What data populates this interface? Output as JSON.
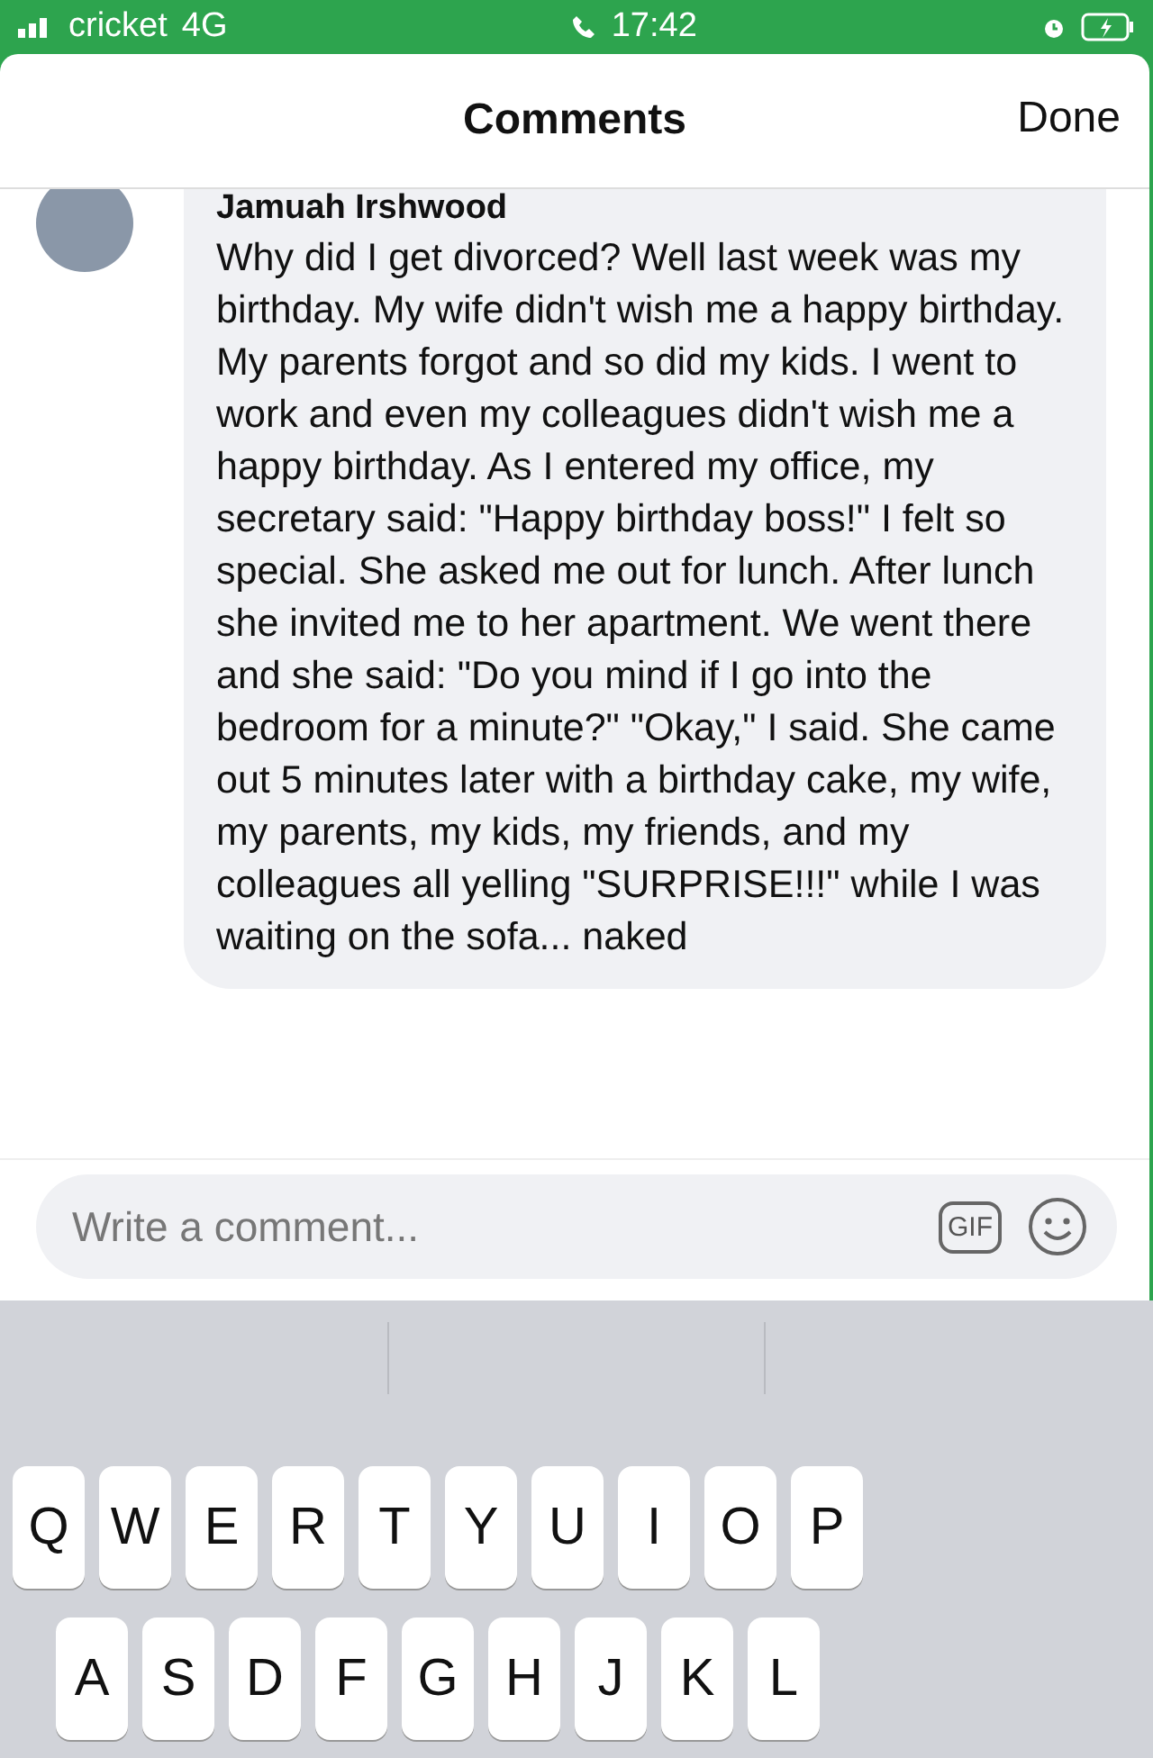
{
  "status_bar": {
    "carrier": "cricket",
    "network": "4G",
    "time": "17:42"
  },
  "header": {
    "title": "Comments",
    "done": "Done"
  },
  "comment": {
    "author": "Jamuah Irshwood",
    "text": "Why did I get divorced? Well last week was my birthday. My wife didn't wish me a happy birthday. My parents forgot and so did my kids. I went to work and even my colleagues didn't wish me a happy birthday. As I entered my office, my secretary said: \"Happy birthday boss!\" I felt so special. She asked me out for lunch. After lunch she invited me to her apartment. We went there and she said: \"Do you mind if I go into the bedroom for a minute?\" \"Okay,\" I said. She came out 5 minutes later with a birthday cake, my wife, my parents, my kids, my friends, and my colleagues all yelling \"SURPRISE!!!\" while I was waiting on the sofa... naked"
  },
  "composer": {
    "placeholder": "Write a comment...",
    "gif": "GIF"
  },
  "keyboard": {
    "rows": [
      [
        "Q",
        "W",
        "E",
        "R",
        "T",
        "Y",
        "U",
        "I",
        "O",
        "P"
      ],
      [
        "A",
        "S",
        "D",
        "F",
        "G",
        "H",
        "J",
        "K",
        "L"
      ]
    ]
  }
}
